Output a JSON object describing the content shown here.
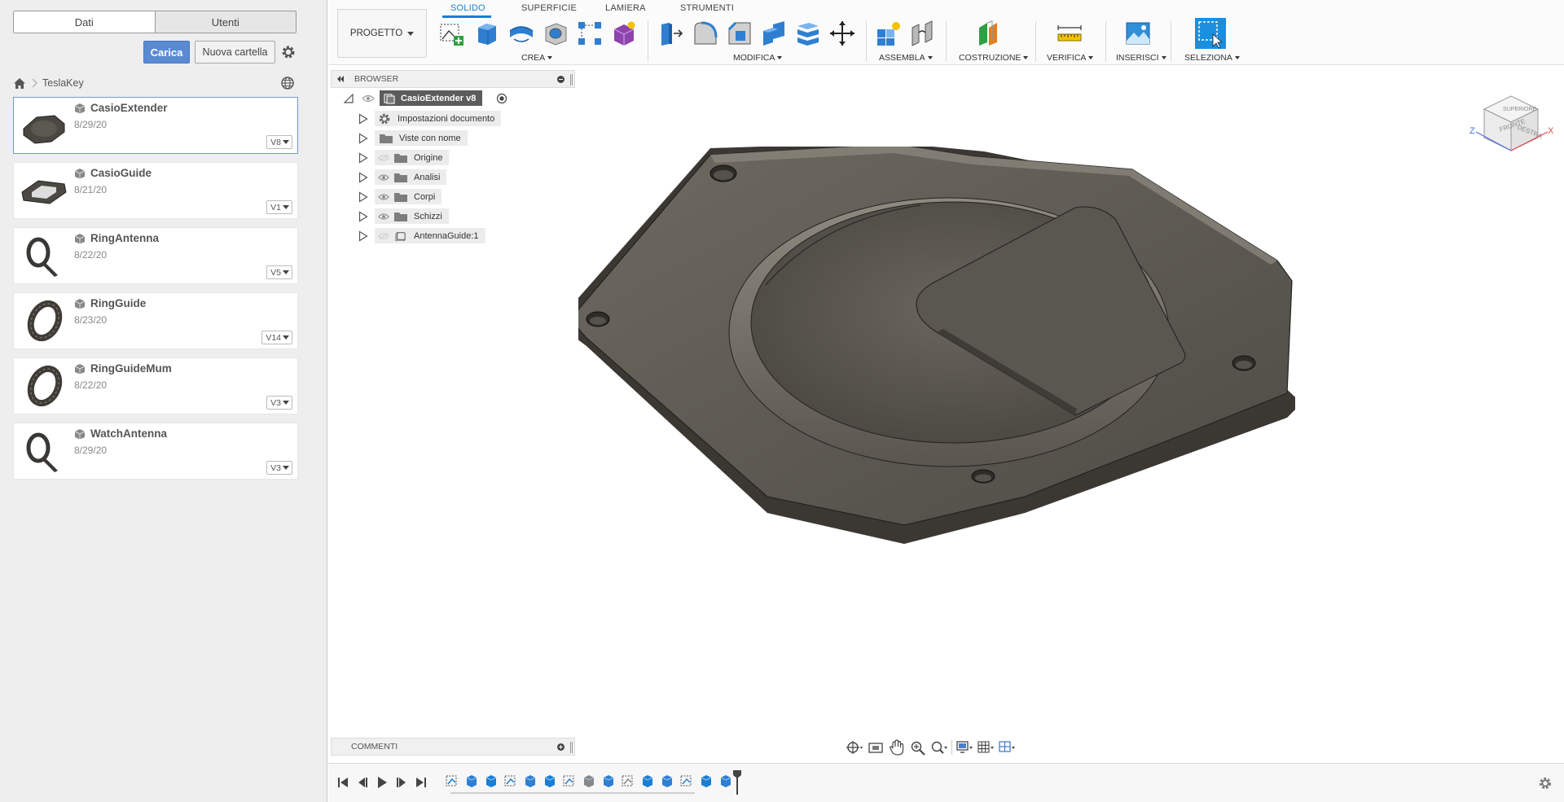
{
  "data_panel": {
    "tabs": [
      "Dati",
      "Utenti"
    ],
    "upload_label": "Carica",
    "new_folder_label": "Nuova cartella",
    "breadcrumb_project": "TeslaKey",
    "files": [
      {
        "name": "CasioExtender",
        "date": "8/29/20",
        "version": "V8",
        "thumb": "plate"
      },
      {
        "name": "CasioGuide",
        "date": "8/21/20",
        "version": "V1",
        "thumb": "frame"
      },
      {
        "name": "RingAntenna",
        "date": "8/22/20",
        "version": "V5",
        "thumb": "ring"
      },
      {
        "name": "RingGuide",
        "date": "8/23/20",
        "version": "V14",
        "thumb": "band"
      },
      {
        "name": "RingGuideMum",
        "date": "8/22/20",
        "version": "V3",
        "thumb": "band"
      },
      {
        "name": "WatchAntenna",
        "date": "8/29/20",
        "version": "V3",
        "thumb": "ring"
      }
    ]
  },
  "toolbar": {
    "workspace_label": "PROGETTO",
    "tabs": [
      "SOLIDO",
      "SUPERFICIE",
      "LAMIERA",
      "STRUMENTI"
    ],
    "active_tab": "SOLIDO",
    "groups": {
      "crea": "CREA",
      "modifica": "MODIFICA",
      "assembla": "ASSEMBLA",
      "costruzione": "COSTRUZIONE",
      "verifica": "VERIFICA",
      "inserisci": "INSERISCI",
      "seleziona": "SELEZIONA"
    }
  },
  "browser": {
    "title": "BROWSER",
    "root": "CasioExtender v8",
    "items": [
      {
        "label": "Impostazioni documento",
        "icon": "gear-icon",
        "eye": "none"
      },
      {
        "label": "Viste con nome",
        "icon": "folder-icon",
        "eye": "none"
      },
      {
        "label": "Origine",
        "icon": "folder-icon",
        "eye": "hidden"
      },
      {
        "label": "Analisi",
        "icon": "folder-icon",
        "eye": "visible"
      },
      {
        "label": "Corpi",
        "icon": "folder-icon",
        "eye": "visible"
      },
      {
        "label": "Schizzi",
        "icon": "folder-icon",
        "eye": "visible"
      },
      {
        "label": "AntennaGuide:1",
        "icon": "component-icon",
        "eye": "hidden"
      }
    ]
  },
  "viewcube": {
    "faces": [
      "FRONTE",
      "DESTRA",
      "SUPERIORE"
    ],
    "axes": [
      "Z",
      "X"
    ]
  },
  "comments": {
    "title": "COMMENTI"
  },
  "colors": {
    "accent": "#1a7ed4",
    "upload_button": "#5a8ad2",
    "model": "#5e5a52"
  }
}
